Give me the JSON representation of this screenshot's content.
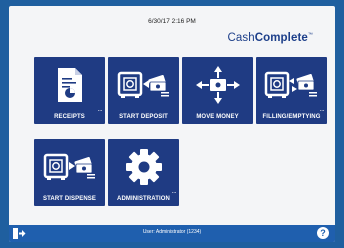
{
  "header": {
    "datetime": "6/30/17 2:16 PM",
    "brand_light": "Cash",
    "brand_bold": "Complete",
    "brand_tm": "™"
  },
  "tiles": [
    {
      "label": "RECEIPTS",
      "icon": "receipt-icon",
      "has_more": true
    },
    {
      "label": "START DEPOSIT",
      "icon": "safe-deposit-icon",
      "has_more": false
    },
    {
      "label": "MOVE MONEY",
      "icon": "move-money-icon",
      "has_more": false
    },
    {
      "label": "FILLING/EMPTYING",
      "icon": "safe-exchange-icon",
      "has_more": true
    },
    {
      "label": "START DISPENSE",
      "icon": "safe-dispense-icon",
      "has_more": false
    },
    {
      "label": "ADMINISTRATION",
      "icon": "gear-icon",
      "has_more": true
    }
  ],
  "more_glyph": "...",
  "footer": {
    "user_text": "User: Administrator (1234)",
    "help_glyph": "?",
    "exit_icon": "exit-icon"
  },
  "colors": {
    "tile": "#1f3b83",
    "footer": "#1f5fae",
    "background": "#1f5f9f",
    "brand": "#1d3f8a"
  }
}
